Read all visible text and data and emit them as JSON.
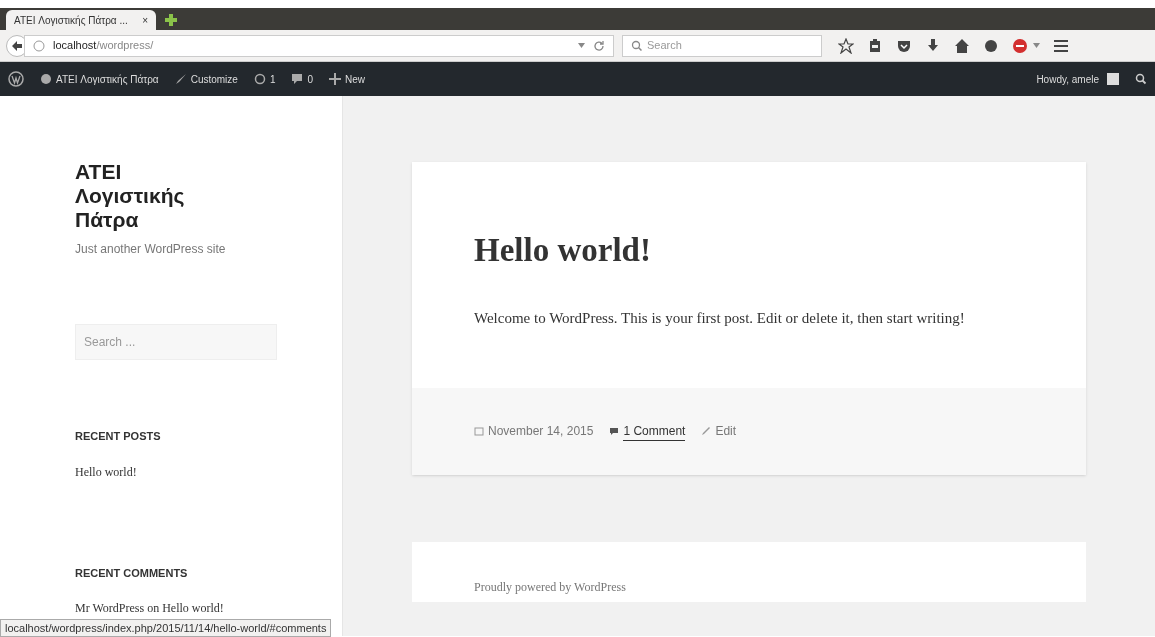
{
  "browser": {
    "tab": {
      "title": "ATEI Λογιστικής Πάτρα ...",
      "close": "×"
    },
    "address_host": "localhost",
    "address_path": "/wordpress/",
    "search_placeholder": "Search"
  },
  "admin_bar": {
    "site": "ATEI Λογιστικής Πάτρα",
    "customize": "Customize",
    "updates": "1",
    "comments": "0",
    "new": "New",
    "howdy": "Howdy, amele"
  },
  "sidebar": {
    "site_title": "ATEI Λογιστικής Πάτρα",
    "tagline": "Just another WordPress site",
    "search_placeholder": "Search ...",
    "widgets": [
      {
        "title": "RECENT POSTS",
        "items": [
          "Hello world!"
        ]
      },
      {
        "title": "RECENT COMMENTS",
        "items": [
          "Mr WordPress on Hello world!"
        ]
      }
    ]
  },
  "post": {
    "title": "Hello world!",
    "body": "Welcome to WordPress. This is your first post. Edit or delete it, then start writing!",
    "date": "November 14, 2015",
    "comments": "1 Comment",
    "edit": "Edit"
  },
  "footer": {
    "text": "Proudly powered by WordPress"
  },
  "status_bar": "localhost/wordpress/index.php/2015/11/14/hello-world/#comments"
}
